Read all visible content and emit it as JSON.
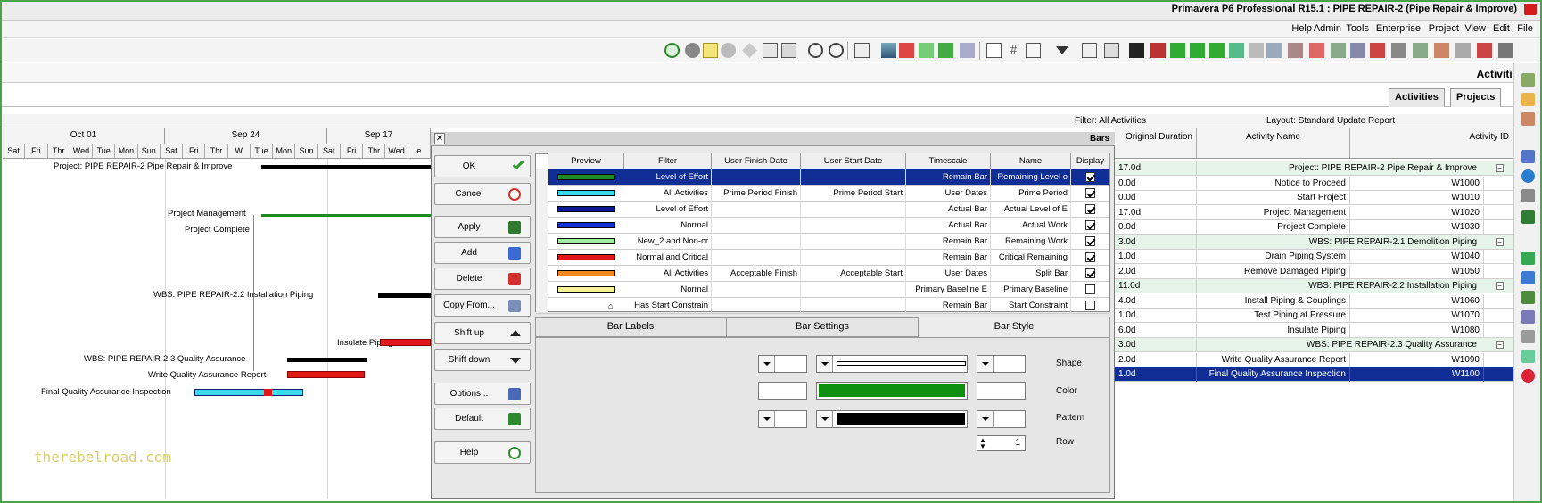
{
  "window": {
    "title": "Primavera P6 Professional R15.1 : PIPE REPAIR-2 (Pipe Repair & Improve)"
  },
  "menu": [
    "File",
    "Edit",
    "View",
    "Project",
    "Enterprise",
    "Tools",
    "Admin",
    "Help"
  ],
  "toolbar_icons": [
    "gantt-icon",
    "columns-icon",
    "filter-icon",
    "group-icon",
    "sort-icon",
    "zoom-in-icon",
    "zoom-out-icon",
    "print-icon",
    "help-icon"
  ],
  "header": {
    "section_title": "Activities"
  },
  "tabs": [
    {
      "label": "Projects"
    },
    {
      "label": "Activities"
    }
  ],
  "layout_bar": {
    "layout": "Layout: Standard Update Report",
    "filter": "Filter: All Activities"
  },
  "gantt": {
    "weeks": [
      "Oct 01",
      "Sep 24",
      "Sep 17"
    ],
    "days": [
      "Sat",
      "Fri",
      "Thr",
      "Wed",
      "Tue",
      "Mon",
      "Sun",
      "Sat",
      "Fri",
      "Thr",
      "W",
      "Tue",
      "Mon",
      "Sun",
      "Sat",
      "Fri",
      "Thr",
      "Wed",
      "e"
    ],
    "labels": [
      "Project: PIPE REPAIR-2  Pipe Repair & Improve",
      "Project Management",
      "Project Complete",
      "WBS: PIPE REPAIR-2.2  Installation Piping",
      "Insulate Piping",
      "WBS: PIPE REPAIR-2.3  Quality Assurance",
      "Write Quality Assurance Report",
      "Final Quality Assurance Inspection"
    ]
  },
  "dialog": {
    "title": "Bars",
    "buttons": [
      {
        "label": "OK",
        "icon": "check-icon"
      },
      {
        "label": "Cancel",
        "icon": "cancel-icon"
      },
      {
        "label": "Apply",
        "icon": "apply-icon"
      },
      {
        "label": "Add",
        "icon": "add-icon"
      },
      {
        "label": "Delete",
        "icon": "delete-icon"
      },
      {
        "label": "Copy From...",
        "icon": "copy-icon"
      },
      {
        "label": "Shift up",
        "icon": "arrow-up-icon"
      },
      {
        "label": "Shift down",
        "icon": "arrow-down-icon"
      },
      {
        "label": "Options...",
        "icon": "options-icon"
      },
      {
        "label": "Default",
        "icon": "default-icon"
      },
      {
        "label": "Help",
        "icon": "help-icon"
      }
    ],
    "columns": [
      "Display",
      "Name",
      "Timescale",
      "User Start Date",
      "User Finish Date",
      "Filter",
      "Preview"
    ],
    "rows": [
      {
        "display": true,
        "name": "Remaining Level o",
        "timescale": "Remain Bar",
        "start": "",
        "finish": "",
        "filter": "Level of Effort",
        "color": "#1e8a1e",
        "selected": true
      },
      {
        "display": true,
        "name": "Prime Period",
        "timescale": "User Dates",
        "start": "Prime Period Start",
        "finish": "Prime Period Finish",
        "filter": "All Activities",
        "color": "#39d9ec"
      },
      {
        "display": true,
        "name": "Actual Level of E",
        "timescale": "Actual Bar",
        "start": "",
        "finish": "",
        "filter": "Level of Effort",
        "color": "#0b1a8c"
      },
      {
        "display": true,
        "name": "Actual Work",
        "timescale": "Actual Bar",
        "start": "",
        "finish": "",
        "filter": "Normal",
        "color": "#1033d6"
      },
      {
        "display": true,
        "name": "Remaining Work",
        "timescale": "Remain Bar",
        "start": "",
        "finish": "",
        "filter": "New_2 and Non-cr",
        "color": "#9eef9e"
      },
      {
        "display": true,
        "name": "Critical Remaining",
        "timescale": "Remain Bar",
        "start": "",
        "finish": "",
        "filter": "Normal and Critical",
        "color": "#e21717"
      },
      {
        "display": true,
        "name": "Split Bar",
        "timescale": "User Dates",
        "start": "Acceptable Start",
        "finish": "Acceptable Finish",
        "filter": "All Activities",
        "color": "#f28a1d"
      },
      {
        "display": false,
        "name": "Primary Baseline",
        "timescale": "Primary Baseline E",
        "start": "",
        "finish": "",
        "filter": "Normal",
        "color": "#f5f29a"
      },
      {
        "display": false,
        "name": "Start Constraint",
        "timescale": "Remain Bar",
        "start": "",
        "finish": "",
        "filter": "Has Start Constrain",
        "color": ""
      }
    ],
    "tabs": [
      "Bar Style",
      "Bar Settings",
      "Bar Labels"
    ],
    "style": {
      "shape_label": "Shape",
      "color_label": "Color",
      "pattern_label": "Pattern",
      "row_label": "Row",
      "row_value": "1",
      "bar_color": "#0f8f0f",
      "pattern_color": "#000000"
    }
  },
  "grid": {
    "columns": [
      "Activity ID",
      "Activity Name",
      "Original Duration"
    ],
    "rows": [
      {
        "id": "Project: PIPE REPAIR-2  Pipe Repair & Improve",
        "name": "",
        "dur": "17.0d",
        "kind": "project"
      },
      {
        "id": "W1000",
        "name": "Notice to Proceed",
        "dur": "0.0d",
        "kind": "task"
      },
      {
        "id": "W1010",
        "name": "Start Project",
        "dur": "0.0d",
        "kind": "task"
      },
      {
        "id": "W1020",
        "name": "Project Management",
        "dur": "17.0d",
        "kind": "task"
      },
      {
        "id": "W1030",
        "name": "Project Complete",
        "dur": "0.0d",
        "kind": "task"
      },
      {
        "id": "WBS: PIPE REPAIR-2.1  Demolition Piping",
        "name": "",
        "dur": "3.0d",
        "kind": "wbs"
      },
      {
        "id": "W1040",
        "name": "Drain Piping System",
        "dur": "1.0d",
        "kind": "task"
      },
      {
        "id": "W1050",
        "name": "Remove Damaged Piping",
        "dur": "2.0d",
        "kind": "task"
      },
      {
        "id": "WBS: PIPE REPAIR-2.2  Installation Piping",
        "name": "",
        "dur": "11.0d",
        "kind": "wbs"
      },
      {
        "id": "W1060",
        "name": "Install Piping & Couplings",
        "dur": "4.0d",
        "kind": "task"
      },
      {
        "id": "W1070",
        "name": "Test Piping at Pressure",
        "dur": "1.0d",
        "kind": "task"
      },
      {
        "id": "W1080",
        "name": "Insulate Piping",
        "dur": "6.0d",
        "kind": "task"
      },
      {
        "id": "WBS: PIPE REPAIR-2.3  Quality Assurance",
        "name": "",
        "dur": "3.0d",
        "kind": "wbs"
      },
      {
        "id": "W1090",
        "name": "Write Quality Assurance Report",
        "dur": "2.0d",
        "kind": "task"
      },
      {
        "id": "W1100",
        "name": "Final Quality Assurance Inspection",
        "dur": "1.0d",
        "kind": "task",
        "selected": true
      }
    ]
  },
  "watermark": "therebelroad.com"
}
